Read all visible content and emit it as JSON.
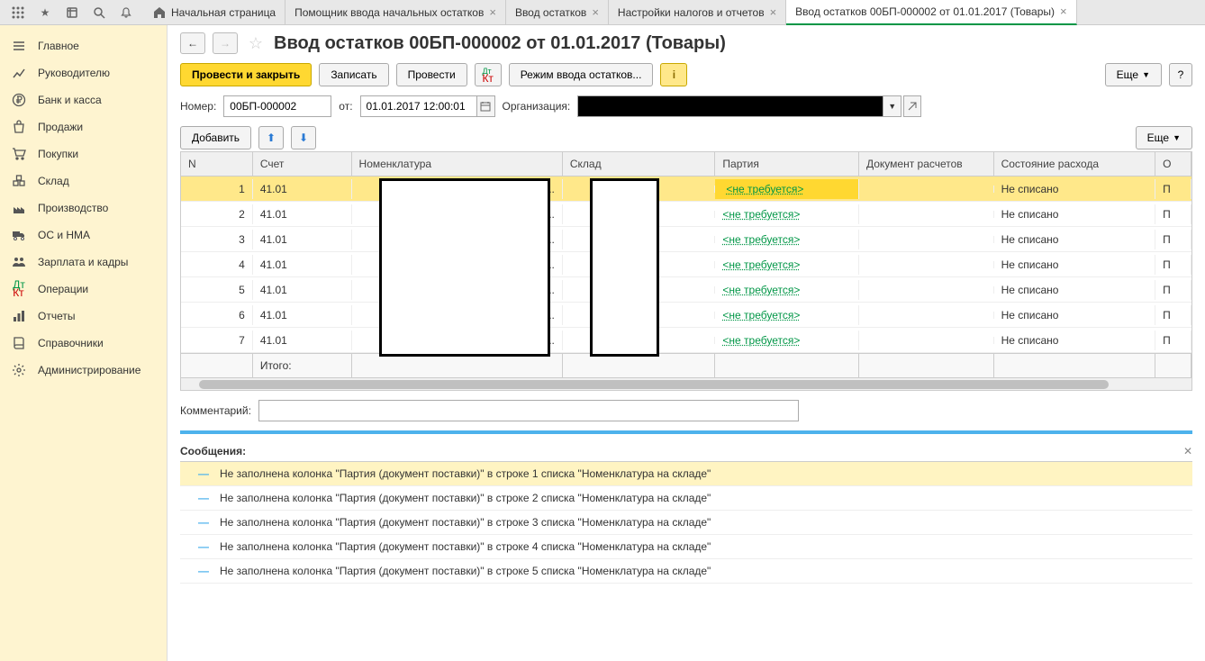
{
  "tabs": [
    {
      "label": "Начальная страница",
      "has_home": true,
      "closable": false
    },
    {
      "label": "Помощник ввода начальных остатков",
      "closable": true
    },
    {
      "label": "Ввод остатков",
      "closable": true
    },
    {
      "label": "Настройки налогов и отчетов",
      "closable": true
    },
    {
      "label": "Ввод остатков 00БП-000002 от 01.01.2017 (Товары)",
      "closable": true,
      "active": true
    }
  ],
  "sidebar": {
    "items": [
      {
        "label": "Главное",
        "icon": "menu"
      },
      {
        "label": "Руководителю",
        "icon": "chart"
      },
      {
        "label": "Банк и касса",
        "icon": "ruble"
      },
      {
        "label": "Продажи",
        "icon": "bag"
      },
      {
        "label": "Покупки",
        "icon": "cart"
      },
      {
        "label": "Склад",
        "icon": "boxes"
      },
      {
        "label": "Производство",
        "icon": "factory"
      },
      {
        "label": "ОС и НМА",
        "icon": "truck"
      },
      {
        "label": "Зарплата и кадры",
        "icon": "people"
      },
      {
        "label": "Операции",
        "icon": "dtk"
      },
      {
        "label": "Отчеты",
        "icon": "bars"
      },
      {
        "label": "Справочники",
        "icon": "book"
      },
      {
        "label": "Администрирование",
        "icon": "gear"
      }
    ]
  },
  "page": {
    "title": "Ввод остатков 00БП-000002 от 01.01.2017 (Товары)"
  },
  "toolbar": {
    "post_close": "Провести и закрыть",
    "save": "Записать",
    "post": "Провести",
    "mode": "Режим ввода остатков...",
    "more": "Еще",
    "help": "?"
  },
  "form": {
    "number_label": "Номер:",
    "number_value": "00БП-000002",
    "from_label": "от:",
    "date_value": "01.01.2017 12:00:01",
    "org_label": "Организация:"
  },
  "table_toolbar": {
    "add": "Добавить",
    "more": "Еще"
  },
  "grid": {
    "headers": {
      "n": "N",
      "account": "Счет",
      "nomenclature": "Номенклатура",
      "warehouse": "Склад",
      "batch": "Партия",
      "doc": "Документ расчетов",
      "state": "Состояние расхода",
      "last": "О"
    },
    "rows": [
      {
        "n": "1",
        "acc": "41.01",
        "batch": "<не требуется>",
        "state": "Не списано",
        "last": "П",
        "sel": true
      },
      {
        "n": "2",
        "acc": "41.01",
        "batch": "<не требуется>",
        "state": "Не списано",
        "last": "П"
      },
      {
        "n": "3",
        "acc": "41.01",
        "batch": "<не требуется>",
        "state": "Не списано",
        "last": "П"
      },
      {
        "n": "4",
        "acc": "41.01",
        "batch": "<не требуется>",
        "state": "Не списано",
        "last": "П"
      },
      {
        "n": "5",
        "acc": "41.01",
        "batch": "<не требуется>",
        "state": "Не списано",
        "last": "П"
      },
      {
        "n": "6",
        "acc": "41.01",
        "batch": "<не требуется>",
        "state": "Не списано",
        "last": "П"
      },
      {
        "n": "7",
        "acc": "41.01",
        "batch": "<не требуется>",
        "state": "Не списано",
        "last": "П"
      }
    ],
    "footer": "Итого:"
  },
  "comment": {
    "label": "Комментарий:"
  },
  "messages": {
    "title": "Сообщения:",
    "items": [
      {
        "text": "Не заполнена колонка \"Партия (документ поставки)\" в строке 1 списка \"Номенклатура на складе\"",
        "hl": true
      },
      {
        "text": "Не заполнена колонка \"Партия (документ поставки)\" в строке 2 списка \"Номенклатура на складе\""
      },
      {
        "text": "Не заполнена колонка \"Партия (документ поставки)\" в строке 3 списка \"Номенклатура на складе\""
      },
      {
        "text": "Не заполнена колонка \"Партия (документ поставки)\" в строке 4 списка \"Номенклатура на складе\""
      },
      {
        "text": "Не заполнена колонка \"Партия (документ поставки)\" в строке 5 списка \"Номенклатура на складе\""
      }
    ]
  }
}
